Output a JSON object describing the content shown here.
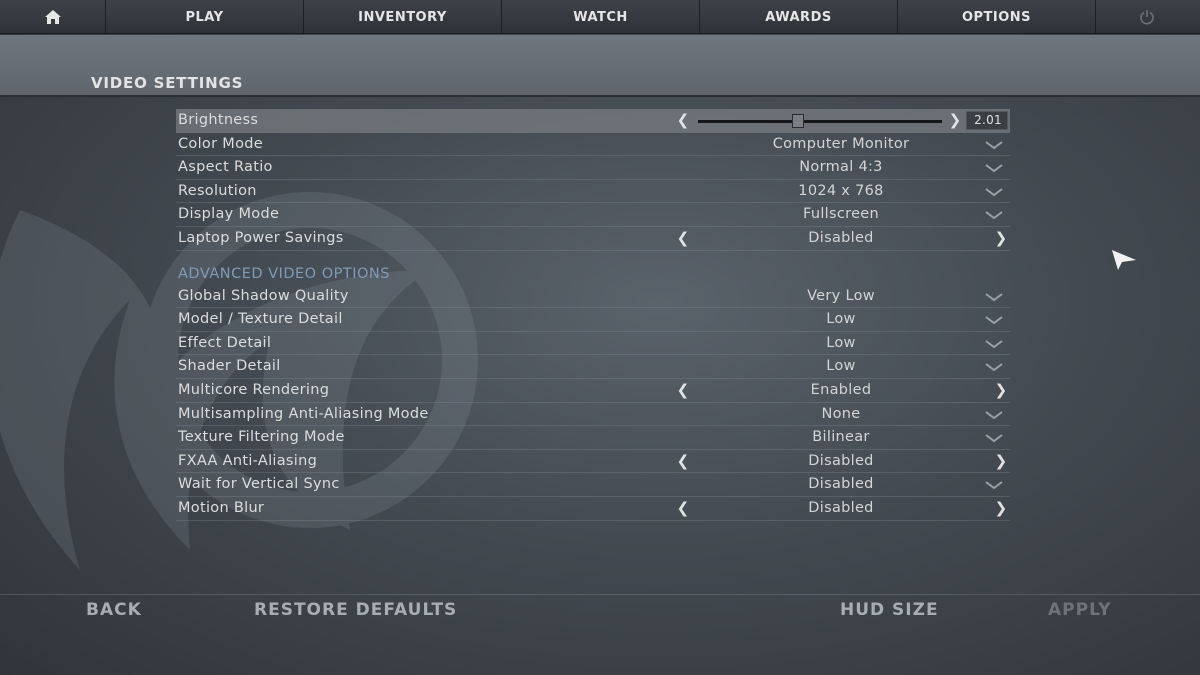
{
  "nav": {
    "home_icon": "home-icon",
    "tabs": [
      {
        "label": "PLAY"
      },
      {
        "label": "INVENTORY"
      },
      {
        "label": "WATCH"
      },
      {
        "label": "AWARDS"
      },
      {
        "label": "OPTIONS"
      }
    ],
    "power_icon": "power-icon"
  },
  "page_title": "VIDEO SETTINGS",
  "basic_settings": [
    {
      "label": "Brightness",
      "control": "slider",
      "value": "2.01",
      "level": 0.41
    },
    {
      "label": "Color Mode",
      "control": "dropdown",
      "value": "Computer Monitor"
    },
    {
      "label": "Aspect Ratio",
      "control": "dropdown",
      "value": "Normal 4:3"
    },
    {
      "label": "Resolution",
      "control": "dropdown",
      "value": "1024 x 768"
    },
    {
      "label": "Display Mode",
      "control": "dropdown",
      "value": "Fullscreen"
    },
    {
      "label": "Laptop Power Savings",
      "control": "toggle",
      "value": "Disabled"
    }
  ],
  "advanced_title": "ADVANCED VIDEO OPTIONS",
  "advanced_settings": [
    {
      "label": "Global Shadow Quality",
      "control": "dropdown",
      "value": "Very Low"
    },
    {
      "label": "Model / Texture Detail",
      "control": "dropdown",
      "value": "Low"
    },
    {
      "label": "Effect Detail",
      "control": "dropdown",
      "value": "Low"
    },
    {
      "label": "Shader Detail",
      "control": "dropdown",
      "value": "Low"
    },
    {
      "label": "Multicore Rendering",
      "control": "toggle",
      "value": "Enabled"
    },
    {
      "label": "Multisampling Anti-Aliasing Mode",
      "control": "dropdown",
      "value": "None"
    },
    {
      "label": "Texture Filtering Mode",
      "control": "dropdown",
      "value": "Bilinear"
    },
    {
      "label": "FXAA Anti-Aliasing",
      "control": "toggle",
      "value": "Disabled"
    },
    {
      "label": "Wait for Vertical Sync",
      "control": "dropdown",
      "value": "Disabled"
    },
    {
      "label": "Motion Blur",
      "control": "toggle",
      "value": "Disabled"
    }
  ],
  "bottom": {
    "back": "BACK",
    "restore_defaults": "RESTORE DEFAULTS",
    "hud_size": "HUD SIZE",
    "apply": "APPLY"
  },
  "colors": {
    "section_accent": "#7f9bb8",
    "highlight_row": "#787c82",
    "apply_disabled": "#6e7378"
  }
}
